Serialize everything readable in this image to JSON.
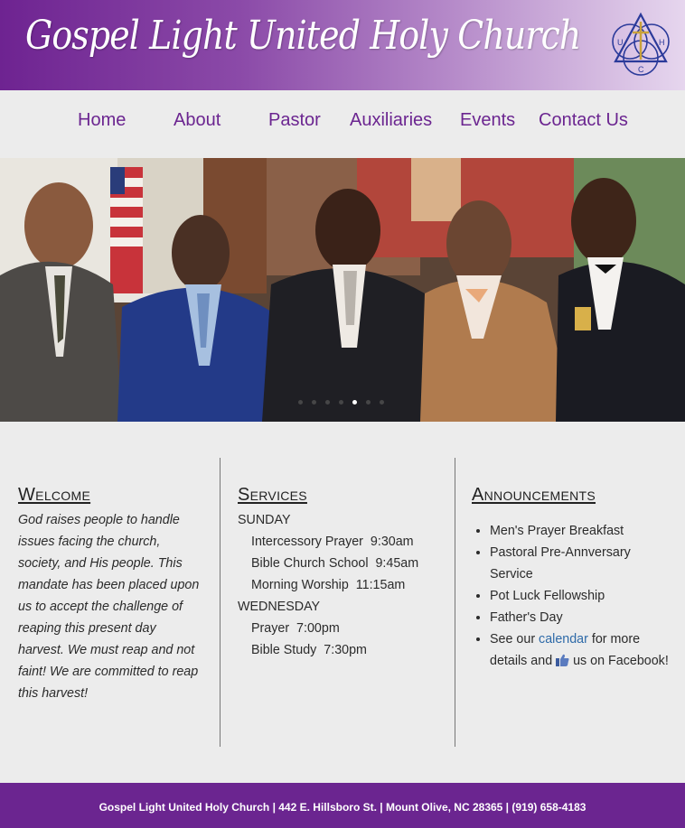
{
  "header": {
    "site_title": "Gospel Light United Holy Church",
    "logo_letters": [
      "U",
      "H",
      "C"
    ]
  },
  "nav": {
    "items": [
      {
        "label": "Home"
      },
      {
        "label": "About"
      },
      {
        "label": "Pastor"
      },
      {
        "label": "Auxiliaries"
      },
      {
        "label": "Events"
      },
      {
        "label": "Contact Us"
      }
    ]
  },
  "hero": {
    "slide_count": 7,
    "active_slide": 5
  },
  "welcome": {
    "heading": "Welcome",
    "text": "God raises people to handle issues facing the church, society, and His people. This mandate has been placed upon us to accept the challenge of reaping this present day harvest. We must reap and not faint! We are committed to reap this harvest!"
  },
  "services": {
    "heading": "Services",
    "days": [
      {
        "day": "SUNDAY",
        "items": [
          "Intercessory Prayer  9:30am",
          "Bible Church School  9:45am",
          "Morning Worship  11:15am"
        ]
      },
      {
        "day": "WEDNESDAY",
        "items": [
          "Prayer  7:00pm",
          "Bible Study  7:30pm"
        ]
      }
    ]
  },
  "announcements": {
    "heading": "Announcements",
    "items": [
      "Men's Prayer Breakfast",
      "Pastoral Pre-Annversary Service",
      "Pot Luck Fellowship",
      "Father's Day"
    ],
    "see_prefix": "See our ",
    "calendar_link": "calendar",
    "see_middle": " for more details and ",
    "see_suffix": " us on Facebook!"
  },
  "footer": {
    "text": "Gospel Light United Holy Church | 442 E. Hillsboro St. | Mount Olive, NC 28365 | (919) 658-4183"
  },
  "colors": {
    "brand_purple": "#6b2590",
    "link_blue": "#2e6aa8",
    "background": "#ececec"
  }
}
